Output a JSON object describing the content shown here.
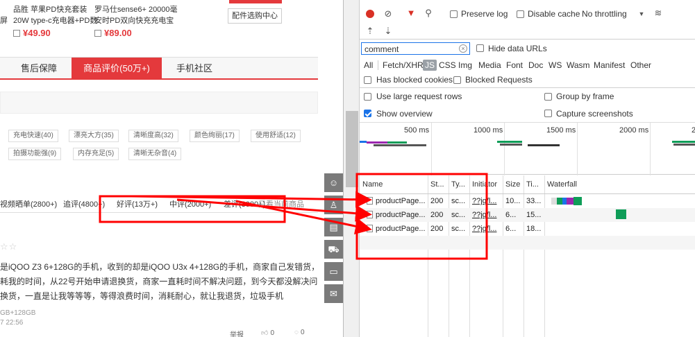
{
  "left": {
    "products": [
      {
        "line1": "品胜 苹果PD快充套装",
        "line2": "20W type-c充电器+PD数",
        "price": "¥49.90"
      },
      {
        "line1": "罗马仕sense6+ 20000毫",
        "line2": "安时PD双向快充充电宝",
        "price": "¥89.00"
      }
    ],
    "left_cut": [
      "屏",
      ""
    ],
    "accessory_button": "配件选购中心",
    "tabs": [
      "售后保障",
      "商品评价(50万+)",
      "手机社区"
    ],
    "tags_row1": [
      "充电快速(40)",
      "漂亮大方(35)",
      "清晰度高(32)",
      "颜色绚丽(17)",
      "使用舒适(12)"
    ],
    "tags_row2": [
      "拍摄功能强(9)",
      "内存充足(5)",
      "清晰无杂音(4)"
    ],
    "filters": [
      "视频晒单(2800+)",
      "追评(4800+)",
      "好评(13万+)",
      "中评(2000+)",
      "差评(3000+)",
      "只看当前商品"
    ],
    "stars": "☆☆",
    "review_lines": [
      "是iQOO Z3 6+128G的手机，收到的却是iQOO U3x 4+128G的手机，商家自己发错货，",
      "耗我的时间，从22号开始申请退换货，商家一直耗时间不解决问题，到今天都没解决问",
      "换货，一直是让我等等等，等得浪费时间，消耗耐心，就让我退货，垃圾手机"
    ],
    "meta1": "GB+128GB",
    "meta2": "7 22:56",
    "footer": {
      "report": "举报",
      "likes": "0",
      "comments": "0"
    }
  },
  "devtools": {
    "toolbar": {
      "preserve_log": "Preserve log",
      "disable_cache": "Disable cache",
      "throttling": "No throttling"
    },
    "filter": {
      "value": "comment",
      "hide_data_urls": "Hide data URLs"
    },
    "types": [
      "All",
      "Fetch/XHR",
      "JS",
      "CSS",
      "Img",
      "Media",
      "Font",
      "Doc",
      "WS",
      "Wasm",
      "Manifest",
      "Other"
    ],
    "has_blocked_cookies": "Has blocked cookies",
    "blocked_requests": "Blocked Requests",
    "use_large_rows": "Use large request rows",
    "group_by_frame": "Group by frame",
    "show_overview": "Show overview",
    "capture_screenshots": "Capture screenshots",
    "overview_ticks": [
      "500 ms",
      "1000 ms",
      "1500 ms",
      "2000 ms",
      "2"
    ],
    "columns": [
      "Name",
      "St...",
      "Ty...",
      "Initiator",
      "Size",
      "Ti...",
      "Waterfall"
    ],
    "rows": [
      {
        "name": "productPage...",
        "status": "200",
        "type": "sc...",
        "initiator": "??jq/l...",
        "size": "10...",
        "time": "33..."
      },
      {
        "name": "productPage...",
        "status": "200",
        "type": "sc...",
        "initiator": "??jq/l...",
        "size": "6...",
        "time": "15..."
      },
      {
        "name": "productPage...",
        "status": "200",
        "type": "sc...",
        "initiator": "??jq/l...",
        "size": "6...",
        "time": "18..."
      }
    ],
    "colors": {
      "accent": "#1a73e8",
      "record": "#d93025",
      "wf_green": "#0f9d58"
    }
  }
}
